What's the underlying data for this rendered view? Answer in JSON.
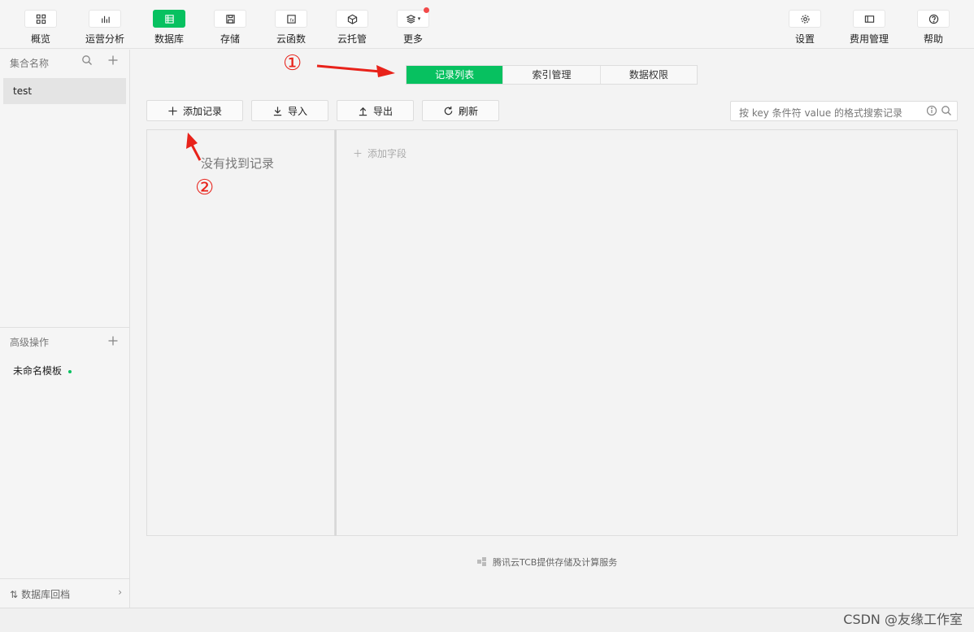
{
  "toolbar": {
    "items": [
      {
        "label": "概览",
        "icon": "grid-icon"
      },
      {
        "label": "运营分析",
        "icon": "bar-chart-icon"
      },
      {
        "label": "数据库",
        "icon": "database-icon",
        "active": true
      },
      {
        "label": "存储",
        "icon": "save-icon"
      },
      {
        "label": "云函数",
        "icon": "function-icon"
      },
      {
        "label": "云托管",
        "icon": "cube-icon"
      },
      {
        "label": "更多",
        "icon": "layers-icon"
      }
    ],
    "right": [
      {
        "label": "设置",
        "icon": "gear-icon"
      },
      {
        "label": "费用管理",
        "icon": "billing-icon"
      },
      {
        "label": "帮助",
        "icon": "help-icon"
      }
    ]
  },
  "sidebar": {
    "collection_header": "集合名称",
    "collections": [
      "test"
    ],
    "advanced_header": "高级操作",
    "templates": [
      "未命名模板"
    ],
    "rollback_label": "数据库回档"
  },
  "tabs": [
    "记录列表",
    "索引管理",
    "数据权限"
  ],
  "actions": {
    "add": "添加记录",
    "import": "导入",
    "export": "导出",
    "refresh": "刷新"
  },
  "search": {
    "placeholder": "按 key 条件符 value 的格式搜索记录"
  },
  "content": {
    "empty": "没有找到记录",
    "add_field": "添加字段"
  },
  "footer": "腾讯云TCB提供存储及计算服务",
  "watermark": "CSDN @友缘工作室",
  "annotations": {
    "one": "①",
    "two": "②"
  },
  "colors": {
    "accent": "#07c160",
    "annotation": "#e8221a"
  }
}
